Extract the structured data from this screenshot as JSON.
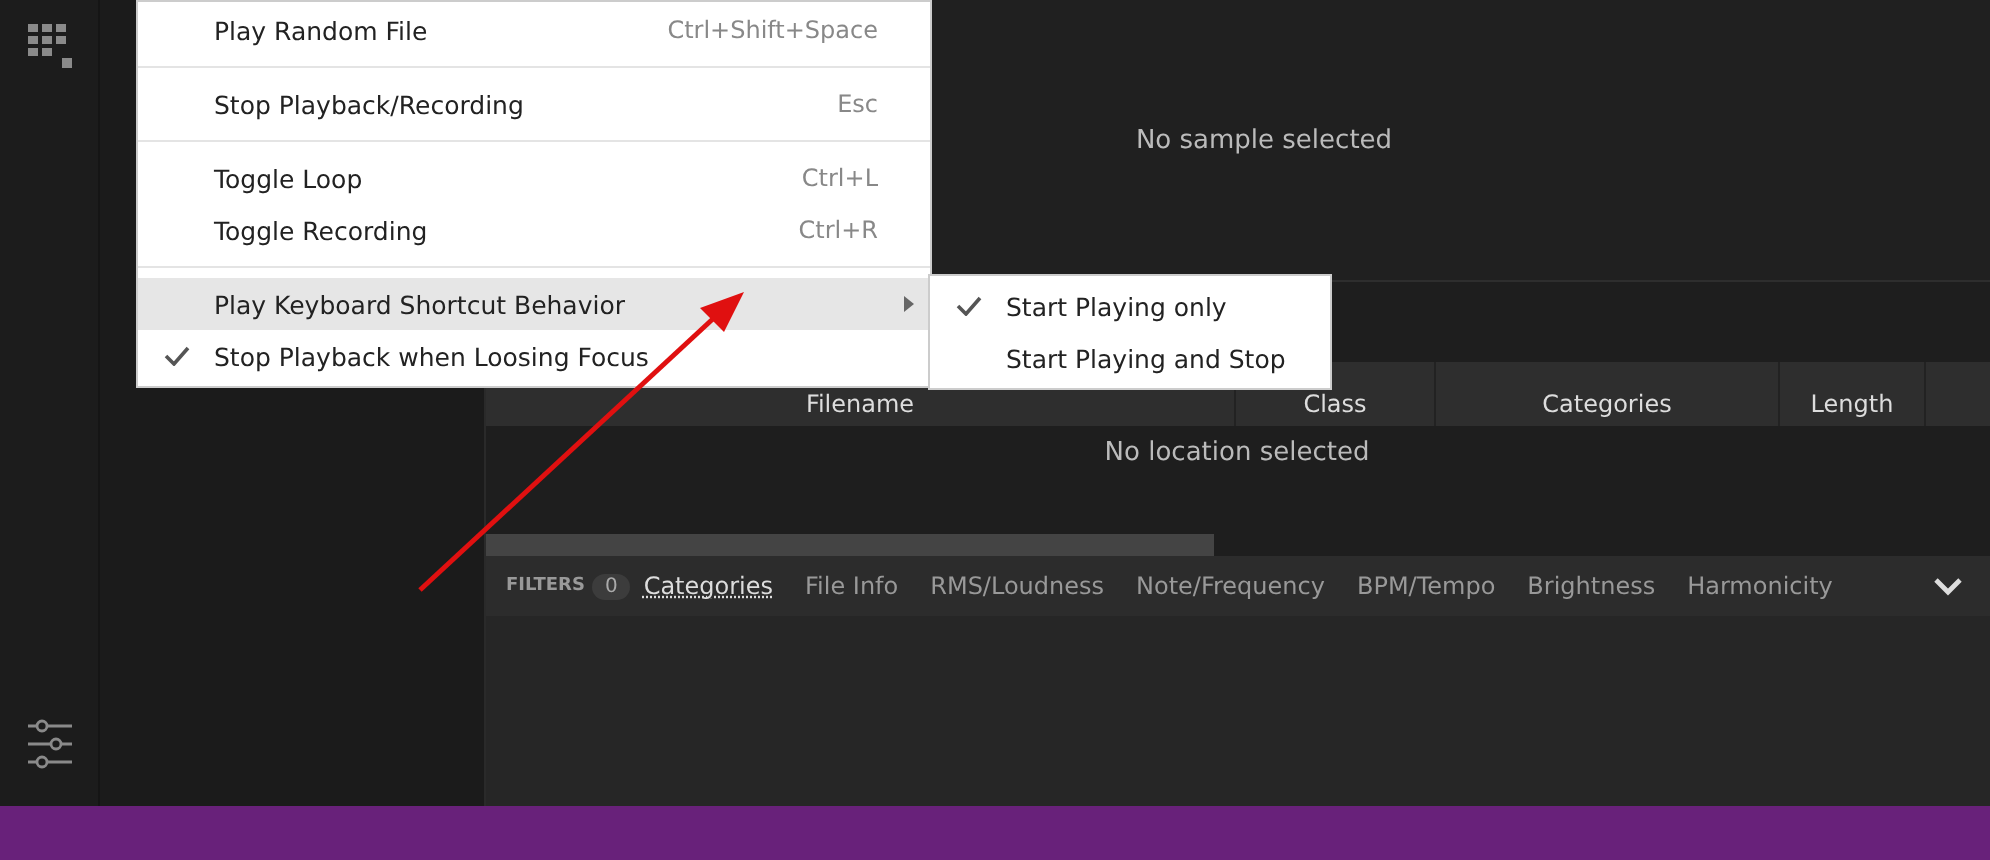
{
  "detail": {
    "message": "No sample selected"
  },
  "menu": {
    "items": [
      {
        "label": "Play Random File",
        "shortcut": "Ctrl+Shift+Space",
        "checked": false,
        "selected": false,
        "submenu": false,
        "separator_after": true
      },
      {
        "label": "Stop Playback/Recording",
        "shortcut": "Esc",
        "checked": false,
        "selected": false,
        "submenu": false,
        "separator_after": true
      },
      {
        "label": "Toggle Loop",
        "shortcut": "Ctrl+L",
        "checked": false,
        "selected": false,
        "submenu": false,
        "separator_after": false
      },
      {
        "label": "Toggle Recording",
        "shortcut": "Ctrl+R",
        "checked": false,
        "selected": false,
        "submenu": false,
        "separator_after": true
      },
      {
        "label": "Play Keyboard Shortcut Behavior",
        "checked": false,
        "selected": true,
        "submenu": true,
        "separator_after": false
      },
      {
        "label": "Stop Playback when Loosing Focus",
        "checked": true,
        "selected": false,
        "submenu": false,
        "separator_after": false
      }
    ]
  },
  "submenu": {
    "items": [
      {
        "label": "Start Playing only",
        "checked": true
      },
      {
        "label": "Start Playing and Stop",
        "checked": false
      }
    ]
  },
  "table": {
    "columns": [
      "Filename",
      "Class",
      "Categories",
      "Length"
    ],
    "empty_message": "No location selected"
  },
  "filters": {
    "label": "FILTERS",
    "count": "0",
    "tabs": [
      {
        "label": "Categories",
        "selected": true
      },
      {
        "label": "File Info",
        "selected": false
      },
      {
        "label": "RMS/Loudness",
        "selected": false
      },
      {
        "label": "Note/Frequency",
        "selected": false
      },
      {
        "label": "BPM/Tempo",
        "selected": false
      },
      {
        "label": "Brightness",
        "selected": false
      },
      {
        "label": "Harmonicity",
        "selected": false
      }
    ]
  }
}
